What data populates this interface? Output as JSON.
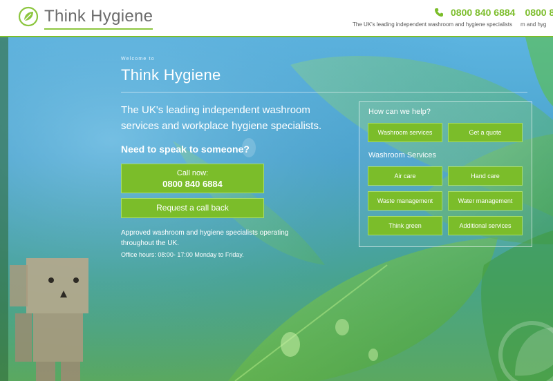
{
  "header": {
    "logo_text": "Think Hygiene",
    "phone": "0800 840 6884",
    "phone_repeat": "0800 8",
    "tagline": "The UK's leading independent washroom and hygiene specialists",
    "tagline_repeat": "m and hyg"
  },
  "hero": {
    "welcome": "Welcome to",
    "title": "Think Hygiene",
    "intro": "The UK's leading independent washroom services and workplace hygiene specialists.",
    "speak_heading": "Need to speak to someone?",
    "call_label": "Call now:",
    "call_number": "0800 840 6884",
    "callback_label": "Request a call back",
    "approved_text": "Approved washroom and hygiene specialists operating throughout the UK.",
    "hours_text": "Office hours: 08:00- 17:00 Monday to Friday."
  },
  "help": {
    "heading": "How can we help?",
    "buttons": [
      "Washroom services",
      "Get a quote"
    ],
    "services_heading": "Washroom Services",
    "services": [
      "Air care",
      "Hand care",
      "Waste management",
      "Water management",
      "Think green",
      "Additional services"
    ]
  },
  "colors": {
    "brand_green": "#7bbd2a",
    "header_bg": "#ffffff"
  },
  "icons": {
    "logo": "leaf-icon",
    "phone": "phone-icon"
  }
}
